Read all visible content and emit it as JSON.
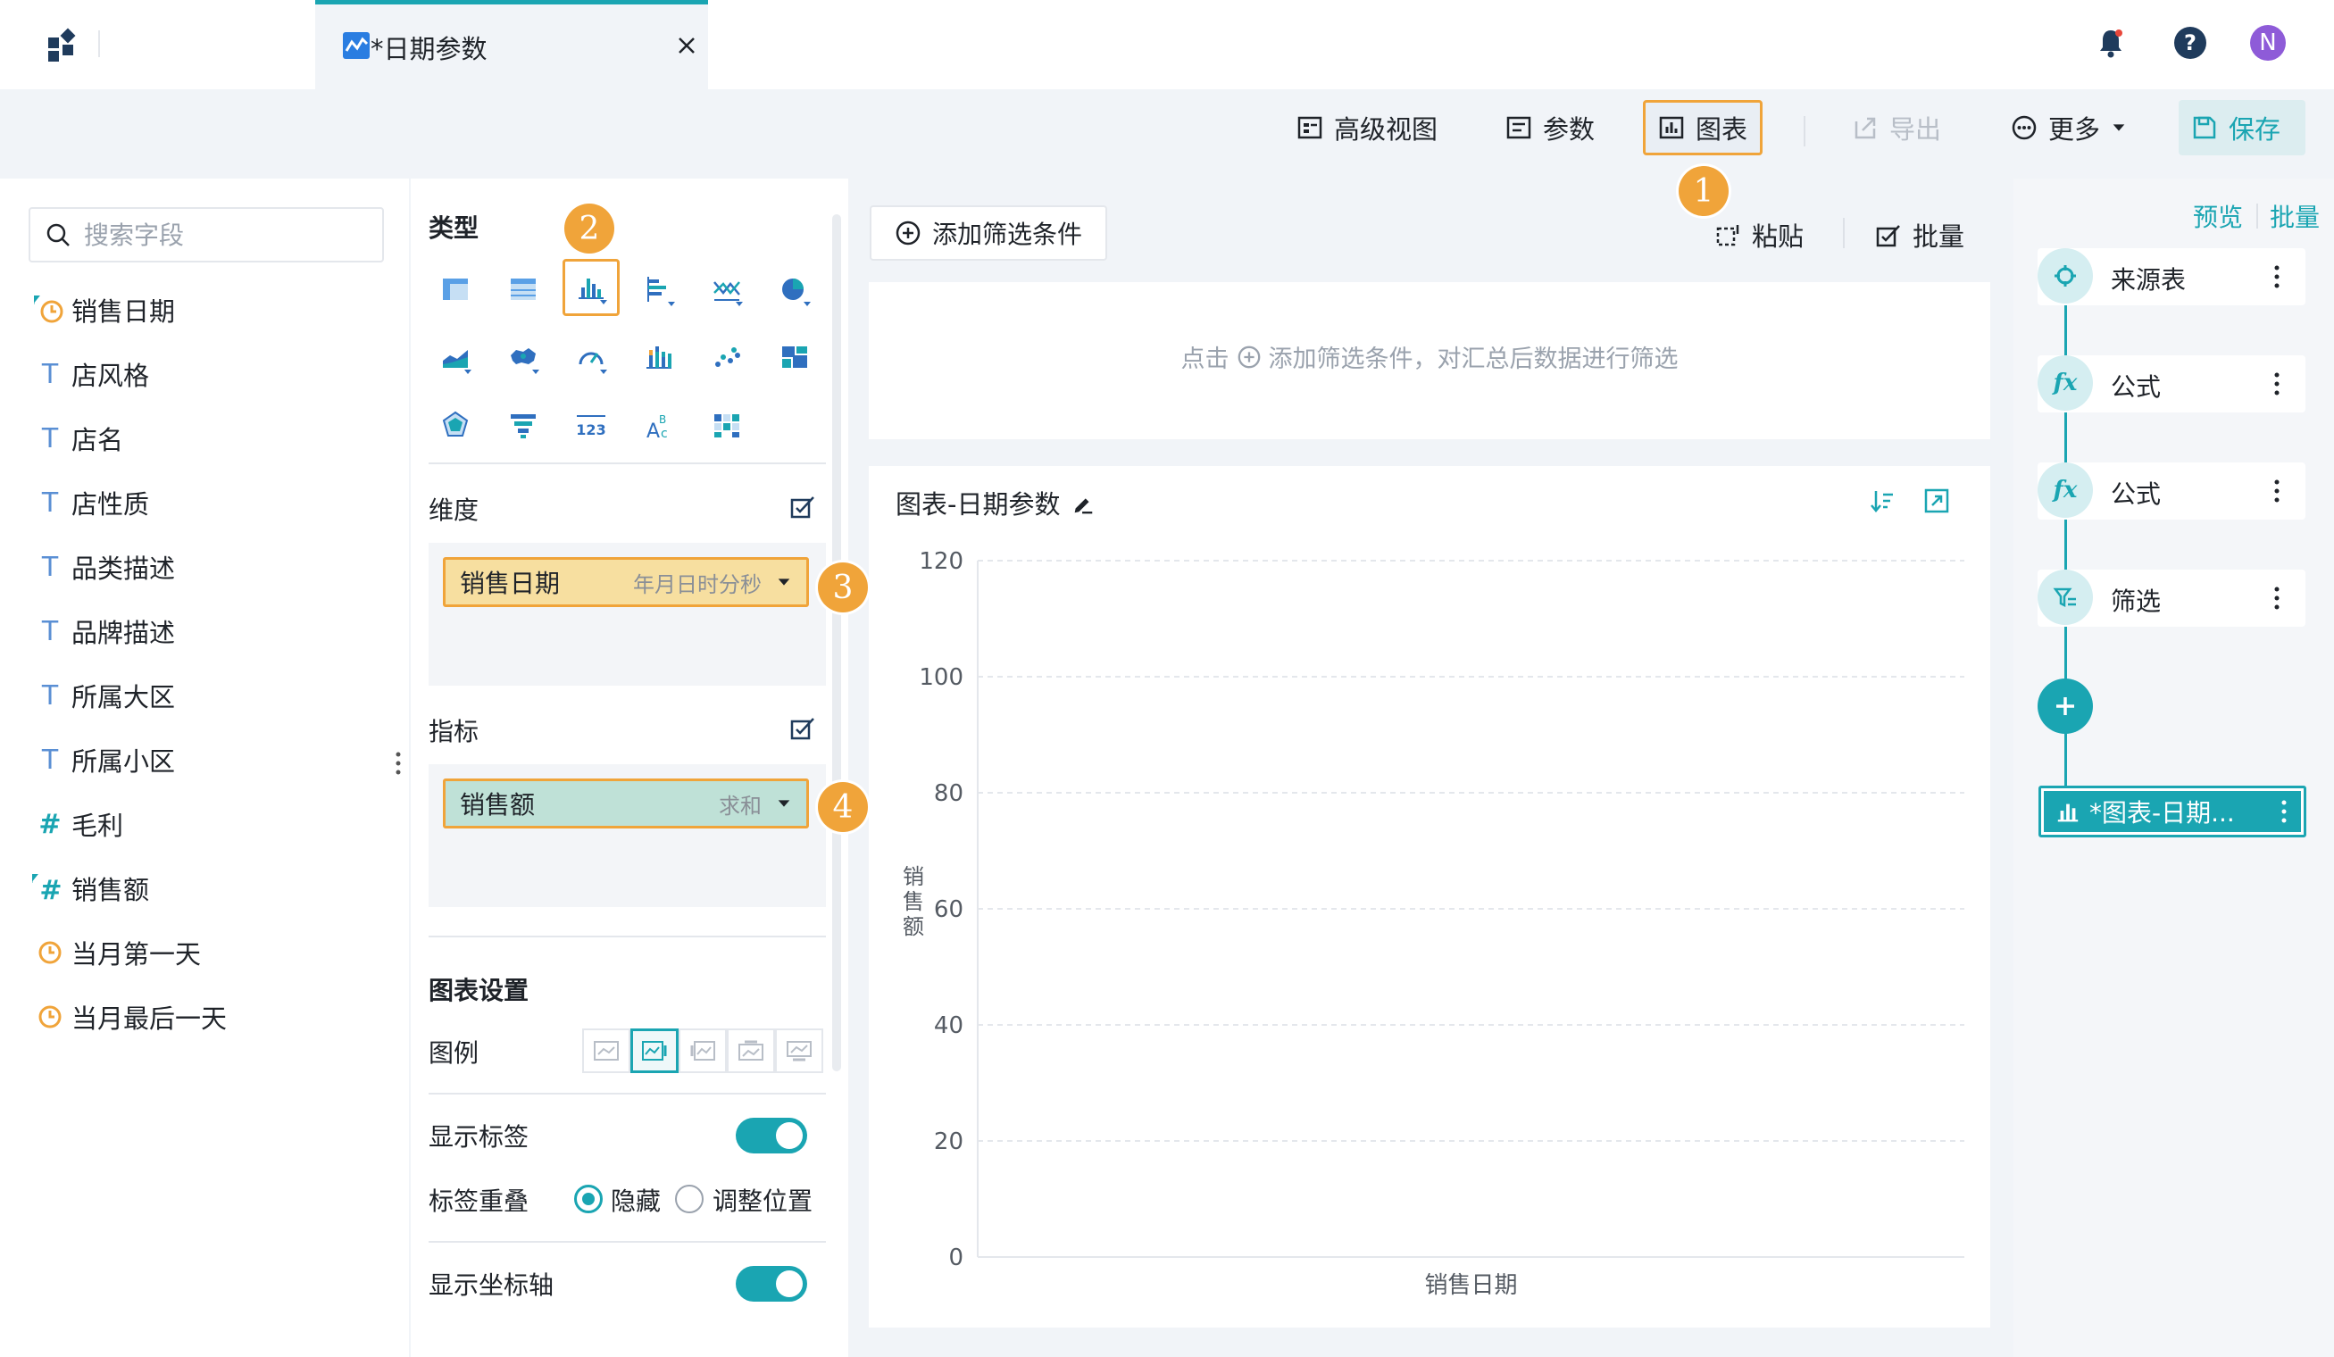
{
  "tabs": {
    "active": "*日期参数"
  },
  "user": {
    "avatar_letter": "N"
  },
  "toolbar": {
    "advanced_view": "高级视图",
    "params": "参数",
    "chart": "图表",
    "export": "导出",
    "more": "更多",
    "save": "保存"
  },
  "markers": [
    "1",
    "2",
    "3",
    "4"
  ],
  "fields": {
    "search_placeholder": "搜索字段",
    "items": [
      {
        "label": "销售日期",
        "icon": "date-clock-icon"
      },
      {
        "label": "店风格",
        "icon": "text-type-icon"
      },
      {
        "label": "店名",
        "icon": "text-type-icon"
      },
      {
        "label": "店性质",
        "icon": "text-type-icon"
      },
      {
        "label": "品类描述",
        "icon": "text-type-icon"
      },
      {
        "label": "品牌描述",
        "icon": "text-type-icon"
      },
      {
        "label": "所属大区",
        "icon": "text-type-icon"
      },
      {
        "label": "所属小区",
        "icon": "text-type-icon"
      },
      {
        "label": "毛利",
        "icon": "number-type-icon"
      },
      {
        "label": "销售额",
        "icon": "number-type-icon"
      },
      {
        "label": "当月第一天",
        "icon": "date-clock-icon"
      },
      {
        "label": "当月最后一天",
        "icon": "date-clock-icon"
      }
    ]
  },
  "config": {
    "type_title": "类型",
    "dimension_title": "维度",
    "dimension_pill": {
      "label": "销售日期",
      "sub": "年月日时分秒"
    },
    "measure_title": "指标",
    "measure_pill": {
      "label": "销售额",
      "sub": "求和"
    },
    "chart_settings_title": "图表设置",
    "legend_label": "图例",
    "show_labels": "显示标签",
    "label_overlap": "标签重叠",
    "overlap_options": [
      "隐藏",
      "调整位置"
    ],
    "show_axis": "显示坐标轴"
  },
  "main": {
    "add_filter": "添加筛选条件",
    "paste": "粘贴",
    "batch": "批量",
    "filter_hint_prefix": "点击",
    "filter_hint_suffix": "添加筛选条件，对汇总后数据进行筛选",
    "chart_title": "图表-日期参数"
  },
  "chart_data": {
    "type": "bar",
    "categories": [],
    "series": [],
    "xlabel": "销售日期",
    "ylabel": "销售额",
    "ylim": [
      0,
      120
    ],
    "yticks": [
      0,
      20,
      40,
      60,
      80,
      100,
      120
    ],
    "grid": true
  },
  "right_panel": {
    "preview": "预览",
    "batch": "批量",
    "steps": [
      {
        "label": "来源表",
        "icon": "source-target-icon"
      },
      {
        "label": "公式",
        "icon": "formula-fx-icon"
      },
      {
        "label": "公式",
        "icon": "formula-fx-icon"
      },
      {
        "label": "筛选",
        "icon": "filter-icon"
      }
    ],
    "active_step": "*图表-日期..."
  },
  "colors": {
    "accent": "#1aa5b2",
    "highlight": "#f0a43a",
    "dimension_pill": "#f7dfa0",
    "measure_pill": "#bfe1d7"
  }
}
